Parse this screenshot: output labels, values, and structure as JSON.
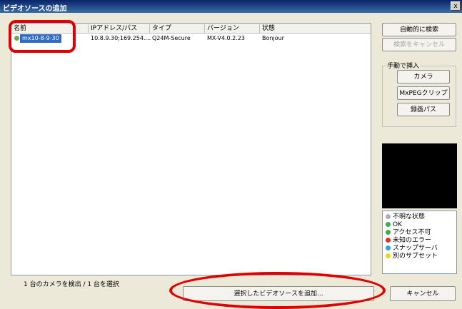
{
  "window": {
    "title": "ビデオソースの追加",
    "close_label": "x"
  },
  "list": {
    "columns": [
      "名前",
      "IPアドレス/パス",
      "タイプ",
      "バージョン",
      "状態"
    ],
    "rows": [
      {
        "name": "mx10-8-9-30",
        "ip": "10.8.9.30;169.254....",
        "type": "Q24M-Secure",
        "version": "MX-V4.0.2.23",
        "status": "Bonjour",
        "status_color": "#6aa84f"
      }
    ]
  },
  "right_panel": {
    "auto_search": "自動的に検索",
    "cancel_search": "検索をキャンセル",
    "manual_group": "手動で挿入",
    "camera": "カメラ",
    "mxpeg_clip": "MxPEGクリップ",
    "recording_path": "録画パス"
  },
  "legend": [
    {
      "label": "不明な状態",
      "color": "#b0b0b0"
    },
    {
      "label": "OK",
      "color": "#3cb043"
    },
    {
      "label": "アクセス不可",
      "color": "#3cb043"
    },
    {
      "label": "未知のエラー",
      "color": "#d93030"
    },
    {
      "label": "スナップサーバ",
      "color": "#2ba6d9"
    },
    {
      "label": "別のサブセット",
      "color": "#f2d31b"
    }
  ],
  "status_text": "1 台のカメラを検出 / 1 台を選択",
  "add_button": "選択したビデオソースを追加...",
  "cancel_button": "キャンセル",
  "annotation_color": "#e00000"
}
